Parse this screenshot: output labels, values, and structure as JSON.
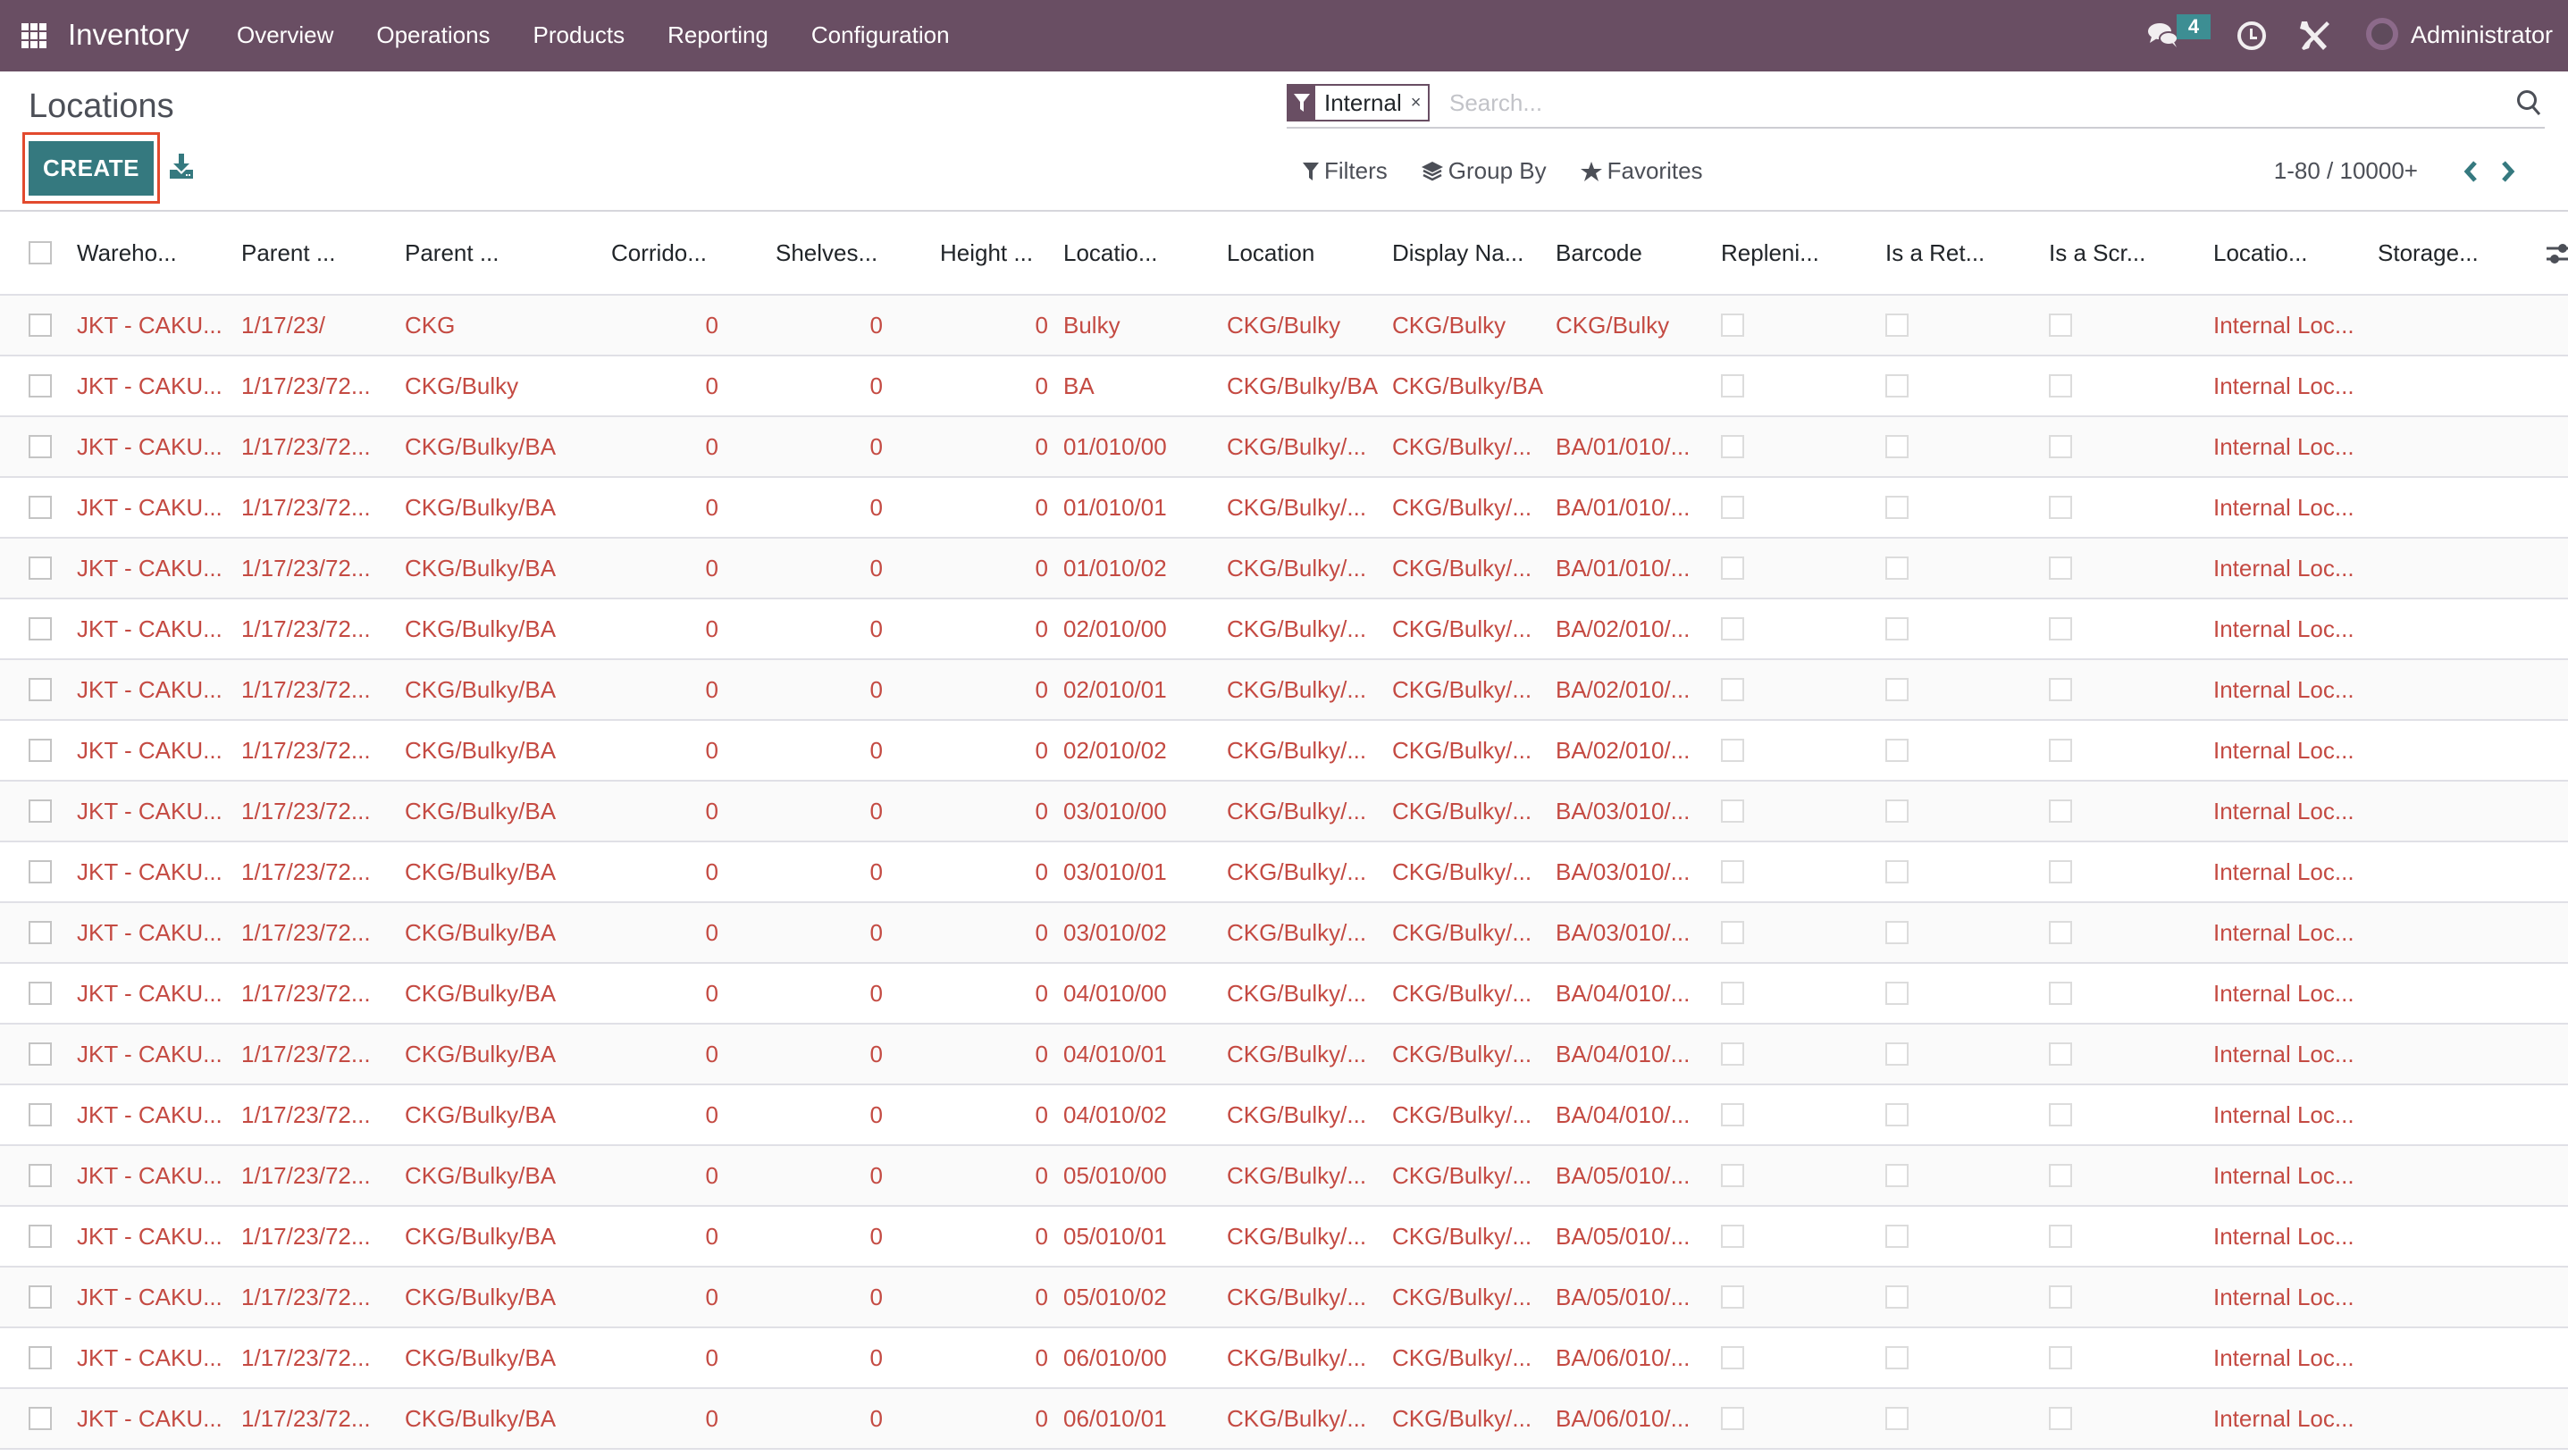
{
  "navbar": {
    "app_name": "Inventory",
    "menu": [
      "Overview",
      "Operations",
      "Products",
      "Reporting",
      "Configuration"
    ],
    "chat_count": "4",
    "user": "Administrator",
    "colors": {
      "bar": "#694e63",
      "badge": "#3d8e93"
    }
  },
  "control_panel": {
    "title": "Locations",
    "create_label": "CREATE",
    "search": {
      "facet_value": "Internal",
      "facet_close": "×",
      "placeholder": "Search...",
      "value": ""
    },
    "options": {
      "filters": "Filters",
      "group_by": "Group By",
      "favorites": "Favorites"
    },
    "pager": "1-80 / 10000+",
    "colors": {
      "primary": "#35797f",
      "highlight": "#e24a2e"
    }
  },
  "table": {
    "columns": [
      "Wareho...",
      "Parent ...",
      "Parent ...",
      "Corrido...",
      "Shelves...",
      "Height ...",
      "Locatio...",
      "Location",
      "Display Na...",
      "Barcode",
      "Repleni...",
      "Is a Ret...",
      "Is a Scr...",
      "Locatio...",
      "Storage..."
    ],
    "rows": [
      {
        "warehouse": "JKT - CAKU...",
        "parent_path": "1/17/23/",
        "parent": "CKG",
        "corridor": "0",
        "shelves": "0",
        "height": "0",
        "loc_name": "Bulky",
        "location": "CKG/Bulky",
        "display_name": "CKG/Bulky",
        "barcode": "CKG/Bulky",
        "replenish": false,
        "is_return": false,
        "is_scrap": false,
        "loc_type": "Internal Loc...",
        "storage": ""
      },
      {
        "warehouse": "JKT - CAKU...",
        "parent_path": "1/17/23/72...",
        "parent": "CKG/Bulky",
        "corridor": "0",
        "shelves": "0",
        "height": "0",
        "loc_name": "BA",
        "location": "CKG/Bulky/BA",
        "display_name": "CKG/Bulky/BA",
        "barcode": "",
        "replenish": false,
        "is_return": false,
        "is_scrap": false,
        "loc_type": "Internal Loc...",
        "storage": ""
      },
      {
        "warehouse": "JKT - CAKU...",
        "parent_path": "1/17/23/72...",
        "parent": "CKG/Bulky/BA",
        "corridor": "0",
        "shelves": "0",
        "height": "0",
        "loc_name": "01/010/00",
        "location": "CKG/Bulky/...",
        "display_name": "CKG/Bulky/...",
        "barcode": "BA/01/010/...",
        "replenish": false,
        "is_return": false,
        "is_scrap": false,
        "loc_type": "Internal Loc...",
        "storage": ""
      },
      {
        "warehouse": "JKT - CAKU...",
        "parent_path": "1/17/23/72...",
        "parent": "CKG/Bulky/BA",
        "corridor": "0",
        "shelves": "0",
        "height": "0",
        "loc_name": "01/010/01",
        "location": "CKG/Bulky/...",
        "display_name": "CKG/Bulky/...",
        "barcode": "BA/01/010/...",
        "replenish": false,
        "is_return": false,
        "is_scrap": false,
        "loc_type": "Internal Loc...",
        "storage": ""
      },
      {
        "warehouse": "JKT - CAKU...",
        "parent_path": "1/17/23/72...",
        "parent": "CKG/Bulky/BA",
        "corridor": "0",
        "shelves": "0",
        "height": "0",
        "loc_name": "01/010/02",
        "location": "CKG/Bulky/...",
        "display_name": "CKG/Bulky/...",
        "barcode": "BA/01/010/...",
        "replenish": false,
        "is_return": false,
        "is_scrap": false,
        "loc_type": "Internal Loc...",
        "storage": ""
      },
      {
        "warehouse": "JKT - CAKU...",
        "parent_path": "1/17/23/72...",
        "parent": "CKG/Bulky/BA",
        "corridor": "0",
        "shelves": "0",
        "height": "0",
        "loc_name": "02/010/00",
        "location": "CKG/Bulky/...",
        "display_name": "CKG/Bulky/...",
        "barcode": "BA/02/010/...",
        "replenish": false,
        "is_return": false,
        "is_scrap": false,
        "loc_type": "Internal Loc...",
        "storage": ""
      },
      {
        "warehouse": "JKT - CAKU...",
        "parent_path": "1/17/23/72...",
        "parent": "CKG/Bulky/BA",
        "corridor": "0",
        "shelves": "0",
        "height": "0",
        "loc_name": "02/010/01",
        "location": "CKG/Bulky/...",
        "display_name": "CKG/Bulky/...",
        "barcode": "BA/02/010/...",
        "replenish": false,
        "is_return": false,
        "is_scrap": false,
        "loc_type": "Internal Loc...",
        "storage": ""
      },
      {
        "warehouse": "JKT - CAKU...",
        "parent_path": "1/17/23/72...",
        "parent": "CKG/Bulky/BA",
        "corridor": "0",
        "shelves": "0",
        "height": "0",
        "loc_name": "02/010/02",
        "location": "CKG/Bulky/...",
        "display_name": "CKG/Bulky/...",
        "barcode": "BA/02/010/...",
        "replenish": false,
        "is_return": false,
        "is_scrap": false,
        "loc_type": "Internal Loc...",
        "storage": ""
      },
      {
        "warehouse": "JKT - CAKU...",
        "parent_path": "1/17/23/72...",
        "parent": "CKG/Bulky/BA",
        "corridor": "0",
        "shelves": "0",
        "height": "0",
        "loc_name": "03/010/00",
        "location": "CKG/Bulky/...",
        "display_name": "CKG/Bulky/...",
        "barcode": "BA/03/010/...",
        "replenish": false,
        "is_return": false,
        "is_scrap": false,
        "loc_type": "Internal Loc...",
        "storage": ""
      },
      {
        "warehouse": "JKT - CAKU...",
        "parent_path": "1/17/23/72...",
        "parent": "CKG/Bulky/BA",
        "corridor": "0",
        "shelves": "0",
        "height": "0",
        "loc_name": "03/010/01",
        "location": "CKG/Bulky/...",
        "display_name": "CKG/Bulky/...",
        "barcode": "BA/03/010/...",
        "replenish": false,
        "is_return": false,
        "is_scrap": false,
        "loc_type": "Internal Loc...",
        "storage": ""
      },
      {
        "warehouse": "JKT - CAKU...",
        "parent_path": "1/17/23/72...",
        "parent": "CKG/Bulky/BA",
        "corridor": "0",
        "shelves": "0",
        "height": "0",
        "loc_name": "03/010/02",
        "location": "CKG/Bulky/...",
        "display_name": "CKG/Bulky/...",
        "barcode": "BA/03/010/...",
        "replenish": false,
        "is_return": false,
        "is_scrap": false,
        "loc_type": "Internal Loc...",
        "storage": ""
      },
      {
        "warehouse": "JKT - CAKU...",
        "parent_path": "1/17/23/72...",
        "parent": "CKG/Bulky/BA",
        "corridor": "0",
        "shelves": "0",
        "height": "0",
        "loc_name": "04/010/00",
        "location": "CKG/Bulky/...",
        "display_name": "CKG/Bulky/...",
        "barcode": "BA/04/010/...",
        "replenish": false,
        "is_return": false,
        "is_scrap": false,
        "loc_type": "Internal Loc...",
        "storage": ""
      },
      {
        "warehouse": "JKT - CAKU...",
        "parent_path": "1/17/23/72...",
        "parent": "CKG/Bulky/BA",
        "corridor": "0",
        "shelves": "0",
        "height": "0",
        "loc_name": "04/010/01",
        "location": "CKG/Bulky/...",
        "display_name": "CKG/Bulky/...",
        "barcode": "BA/04/010/...",
        "replenish": false,
        "is_return": false,
        "is_scrap": false,
        "loc_type": "Internal Loc...",
        "storage": ""
      },
      {
        "warehouse": "JKT - CAKU...",
        "parent_path": "1/17/23/72...",
        "parent": "CKG/Bulky/BA",
        "corridor": "0",
        "shelves": "0",
        "height": "0",
        "loc_name": "04/010/02",
        "location": "CKG/Bulky/...",
        "display_name": "CKG/Bulky/...",
        "barcode": "BA/04/010/...",
        "replenish": false,
        "is_return": false,
        "is_scrap": false,
        "loc_type": "Internal Loc...",
        "storage": ""
      },
      {
        "warehouse": "JKT - CAKU...",
        "parent_path": "1/17/23/72...",
        "parent": "CKG/Bulky/BA",
        "corridor": "0",
        "shelves": "0",
        "height": "0",
        "loc_name": "05/010/00",
        "location": "CKG/Bulky/...",
        "display_name": "CKG/Bulky/...",
        "barcode": "BA/05/010/...",
        "replenish": false,
        "is_return": false,
        "is_scrap": false,
        "loc_type": "Internal Loc...",
        "storage": ""
      },
      {
        "warehouse": "JKT - CAKU...",
        "parent_path": "1/17/23/72...",
        "parent": "CKG/Bulky/BA",
        "corridor": "0",
        "shelves": "0",
        "height": "0",
        "loc_name": "05/010/01",
        "location": "CKG/Bulky/...",
        "display_name": "CKG/Bulky/...",
        "barcode": "BA/05/010/...",
        "replenish": false,
        "is_return": false,
        "is_scrap": false,
        "loc_type": "Internal Loc...",
        "storage": ""
      },
      {
        "warehouse": "JKT - CAKU...",
        "parent_path": "1/17/23/72...",
        "parent": "CKG/Bulky/BA",
        "corridor": "0",
        "shelves": "0",
        "height": "0",
        "loc_name": "05/010/02",
        "location": "CKG/Bulky/...",
        "display_name": "CKG/Bulky/...",
        "barcode": "BA/05/010/...",
        "replenish": false,
        "is_return": false,
        "is_scrap": false,
        "loc_type": "Internal Loc...",
        "storage": ""
      },
      {
        "warehouse": "JKT - CAKU...",
        "parent_path": "1/17/23/72...",
        "parent": "CKG/Bulky/BA",
        "corridor": "0",
        "shelves": "0",
        "height": "0",
        "loc_name": "06/010/00",
        "location": "CKG/Bulky/...",
        "display_name": "CKG/Bulky/...",
        "barcode": "BA/06/010/...",
        "replenish": false,
        "is_return": false,
        "is_scrap": false,
        "loc_type": "Internal Loc...",
        "storage": ""
      },
      {
        "warehouse": "JKT - CAKU...",
        "parent_path": "1/17/23/72...",
        "parent": "CKG/Bulky/BA",
        "corridor": "0",
        "shelves": "0",
        "height": "0",
        "loc_name": "06/010/01",
        "location": "CKG/Bulky/...",
        "display_name": "CKG/Bulky/...",
        "barcode": "BA/06/010/...",
        "replenish": false,
        "is_return": false,
        "is_scrap": false,
        "loc_type": "Internal Loc...",
        "storage": ""
      }
    ],
    "colors": {
      "link_text": "#c44a42",
      "stripe": "#fafafa",
      "border": "#e0e0e6"
    }
  }
}
